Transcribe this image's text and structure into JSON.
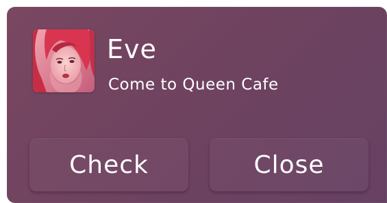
{
  "notification": {
    "sender_name": "Eve",
    "message": "Come to Queen Cafe",
    "avatar_icon": "contact-avatar",
    "background_color": "#6f4360"
  },
  "actions": {
    "check_label": "Check",
    "close_label": "Close"
  }
}
